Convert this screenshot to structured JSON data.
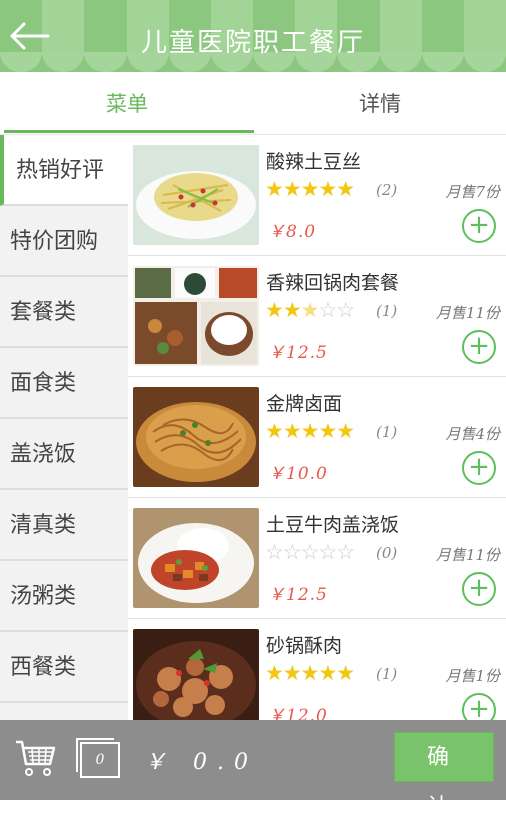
{
  "header": {
    "title": "儿童医院职工餐厅"
  },
  "tabs": [
    {
      "label": "菜单"
    },
    {
      "label": "详情"
    }
  ],
  "categories": [
    {
      "label": "热销好评"
    },
    {
      "label": "特价团购"
    },
    {
      "label": "套餐类"
    },
    {
      "label": "面食类"
    },
    {
      "label": "盖浇饭"
    },
    {
      "label": "清真类"
    },
    {
      "label": "汤粥类"
    },
    {
      "label": "西餐类"
    }
  ],
  "dishes": [
    {
      "name": "酸辣土豆丝",
      "rating": 5,
      "rating_count": "(2)",
      "sold": "月售7份",
      "price": "￥8.0",
      "image": "shredded-potato-icon"
    },
    {
      "name": "香辣回锅肉套餐",
      "rating": 2.5,
      "rating_count": "(1)",
      "sold": "月售11份",
      "price": "￥12.5",
      "image": "set-meal-icon"
    },
    {
      "name": "金牌卤面",
      "rating": 5,
      "rating_count": "(1)",
      "sold": "月售4份",
      "price": "￥10.0",
      "image": "noodles-icon"
    },
    {
      "name": "土豆牛肉盖浇饭",
      "rating": 0,
      "rating_count": "(0)",
      "sold": "月售11份",
      "price": "￥12.5",
      "image": "rice-bowl-icon"
    },
    {
      "name": "砂锅酥肉",
      "rating": 5,
      "rating_count": "(1)",
      "sold": "月售1份",
      "price": "￥12.0",
      "image": "casserole-icon"
    }
  ],
  "bottom": {
    "count": "0",
    "total": "￥ 0.0",
    "confirm_label": "确 认"
  },
  "colors": {
    "accent": "#6ab85c",
    "header": "#8cc77f",
    "price": "#e8584a",
    "star": "#f3c614",
    "bottom_bar": "#8d8d8d"
  }
}
